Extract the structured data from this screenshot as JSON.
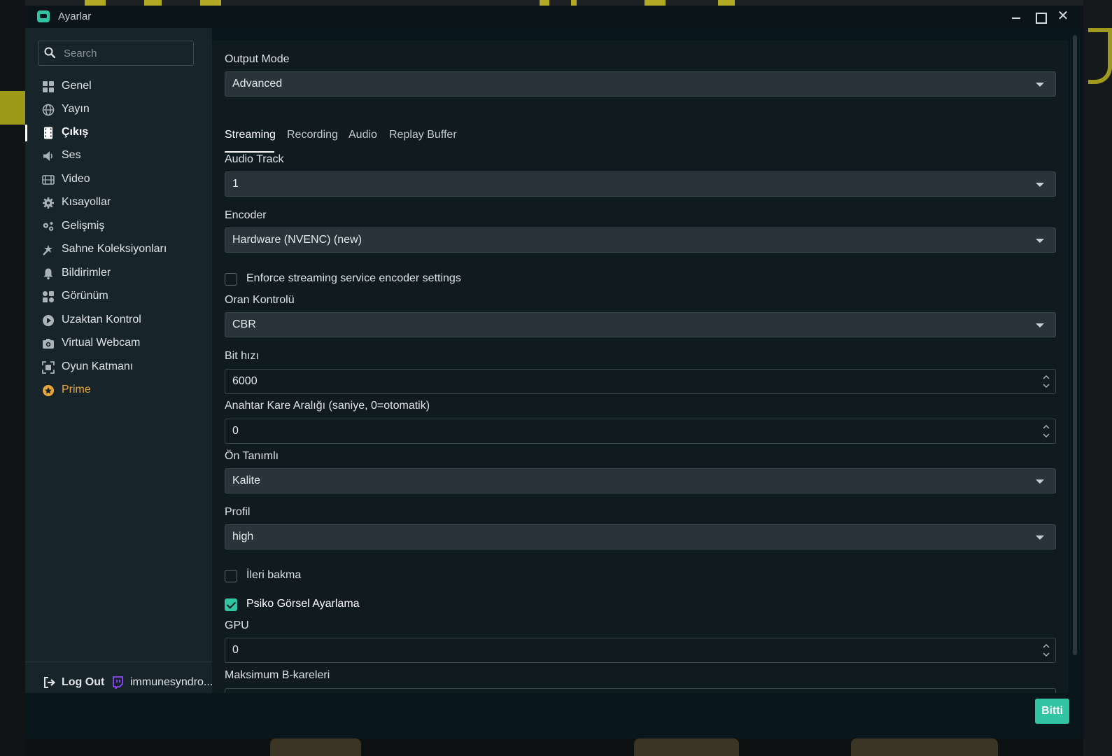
{
  "window": {
    "title": "Ayarlar"
  },
  "search": {
    "placeholder": "Search",
    "value": ""
  },
  "sidebar": {
    "items": [
      {
        "label": "Genel",
        "icon": "grid-icon"
      },
      {
        "label": "Yayın",
        "icon": "globe-icon"
      },
      {
        "label": "Çıkış",
        "icon": "film-strip-icon"
      },
      {
        "label": "Ses",
        "icon": "speaker-icon"
      },
      {
        "label": "Video",
        "icon": "film-icon"
      },
      {
        "label": "Kısayollar",
        "icon": "gear-icon"
      },
      {
        "label": "Gelişmiş",
        "icon": "gears-icon"
      },
      {
        "label": "Sahne Koleksiyonları",
        "icon": "collection-icon"
      },
      {
        "label": "Bildirimler",
        "icon": "bell-icon"
      },
      {
        "label": "Görünüm",
        "icon": "layout-icon"
      },
      {
        "label": "Uzaktan Kontrol",
        "icon": "play-circle-icon"
      },
      {
        "label": "Virtual Webcam",
        "icon": "camera-icon"
      },
      {
        "label": "Oyun Katmanı",
        "icon": "overlay-icon"
      },
      {
        "label": "Prime",
        "icon": "prime-icon"
      }
    ],
    "active_index": 2,
    "logout_label": "Log Out",
    "account_label": "immunesyndro..."
  },
  "settings": {
    "output_mode_label": "Output Mode",
    "output_mode_value": "Advanced",
    "tabs": [
      "Streaming",
      "Recording",
      "Audio",
      "Replay Buffer"
    ],
    "active_tab": "Streaming",
    "audio_track_label": "Audio Track",
    "audio_track_value": "1",
    "encoder_label": "Encoder",
    "encoder_value": "Hardware (NVENC) (new)",
    "enforce_label": "Enforce streaming service encoder settings",
    "enforce_checked": false,
    "rate_control_label": "Oran Kontrolü",
    "rate_control_value": "CBR",
    "bitrate_label": "Bit hızı",
    "bitrate_value": "6000",
    "keyframe_label": "Anahtar Kare Aralığı (saniye, 0=otomatik)",
    "keyframe_value": "0",
    "preset_label": "Ön Tanımlı",
    "preset_value": "Kalite",
    "profile_label": "Profil",
    "profile_value": "high",
    "lookahead_label": "İleri bakma",
    "lookahead_checked": false,
    "psycho_label": "Psiko Görsel Ayarlama",
    "psycho_checked": true,
    "gpu_label": "GPU",
    "gpu_value": "0",
    "bframes_label": "Maksimum B-kareleri"
  },
  "footer": {
    "done_label": "Bitti"
  },
  "colors": {
    "accent": "#31c3a2",
    "prime": "#e8a63a",
    "background": "#09161b",
    "sidebar": "#17242a"
  }
}
